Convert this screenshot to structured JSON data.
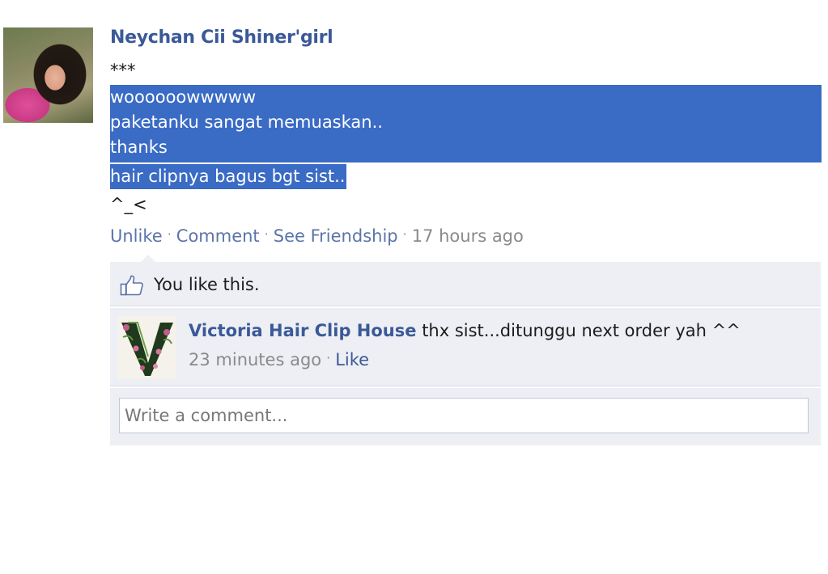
{
  "post": {
    "author": "Neychan Cii Shiner'girl",
    "lines": [
      "***",
      "woooooowwwww",
      "paketanku sangat memuaskan..",
      "thanks",
      "hair clipnya bagus bgt sist..",
      "^_<"
    ]
  },
  "actions": {
    "unlike": "Unlike",
    "comment": "Comment",
    "see_friendship": "See Friendship",
    "timestamp": "17 hours ago",
    "separator": "·"
  },
  "likes": {
    "text": "You like this."
  },
  "comment": {
    "author": "Victoria Hair Clip House",
    "text": "thx sist...ditunggu next order yah ^^",
    "timestamp": "23 minutes ago",
    "like": "Like"
  },
  "write_comment": {
    "placeholder": "Write a comment..."
  },
  "colors": {
    "link": "#3b5998",
    "selection": "#3a6bc5",
    "panel": "#edeff4"
  },
  "icons": {
    "like": "thumbs-up-icon"
  }
}
